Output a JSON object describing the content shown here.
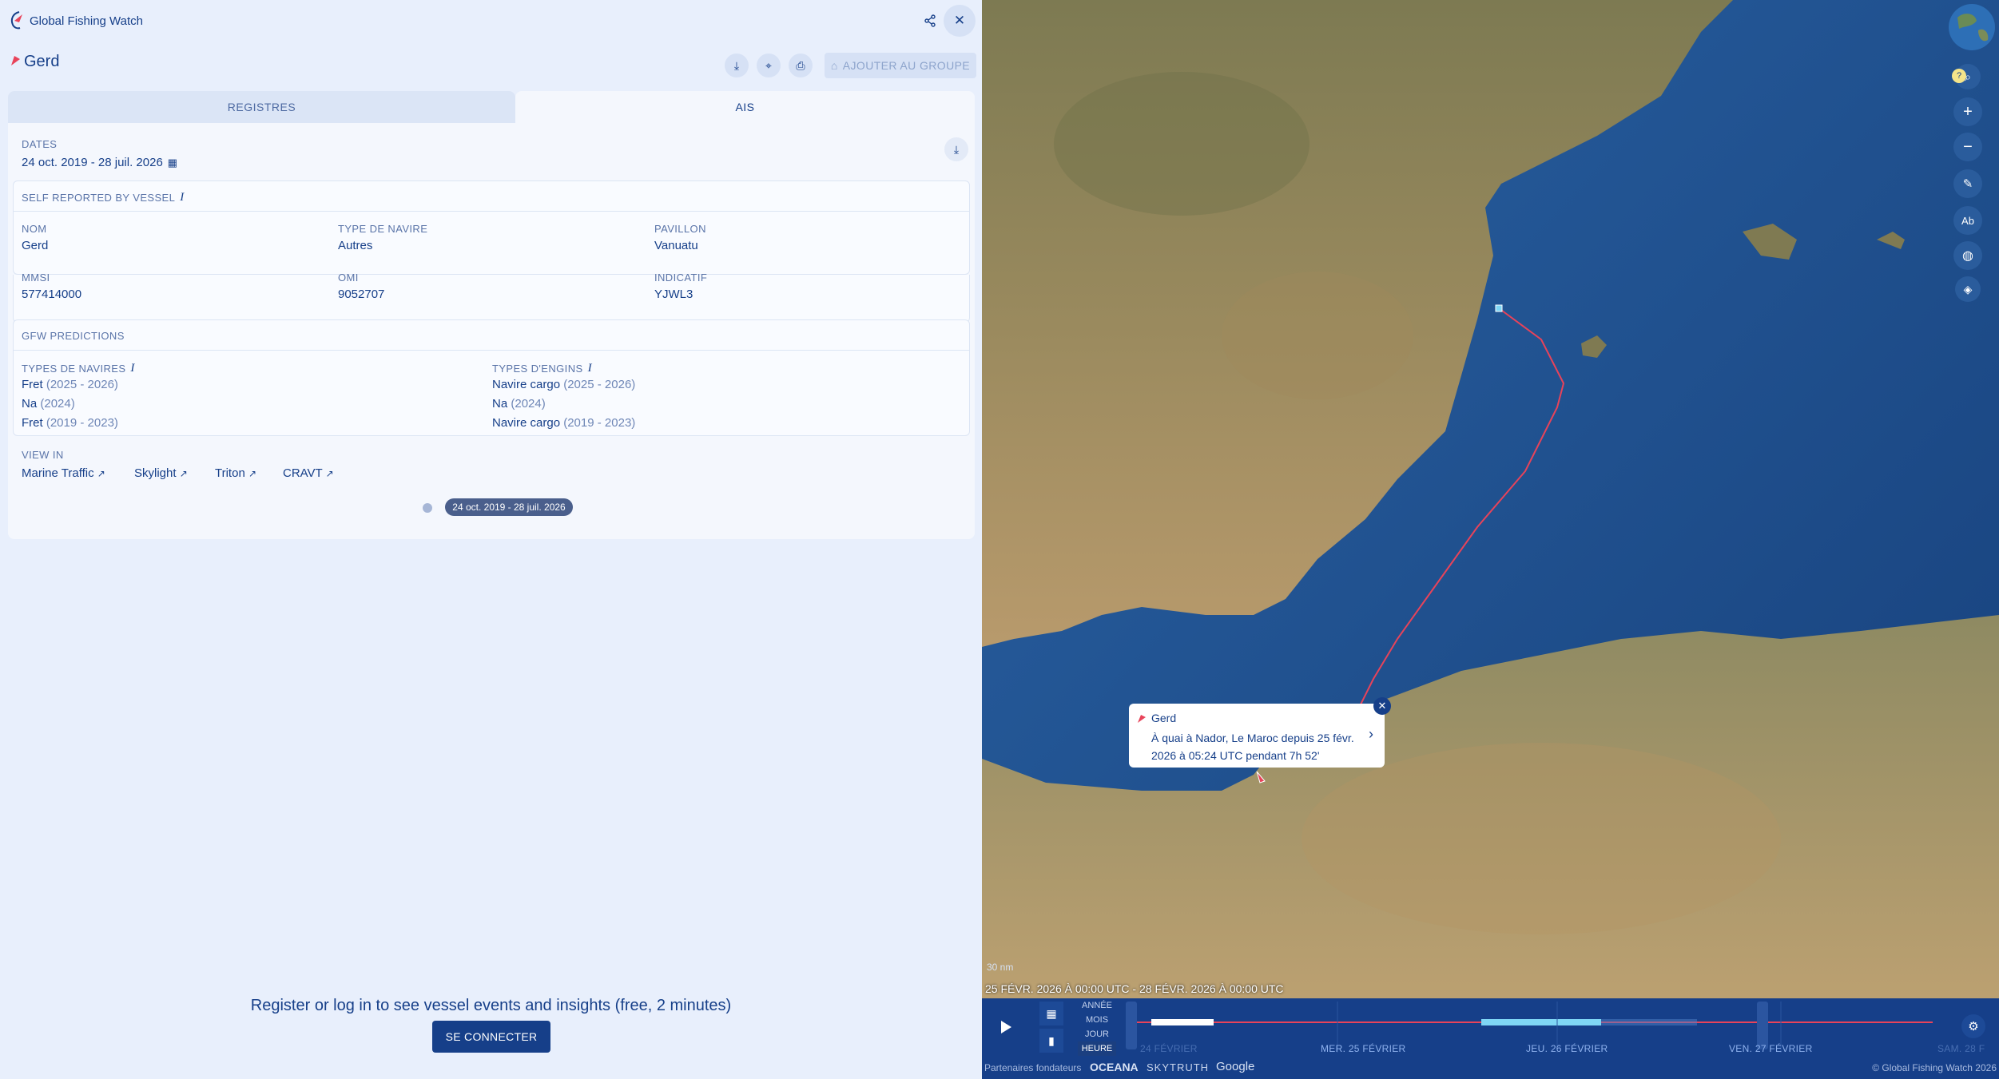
{
  "app": {
    "title": "Global Fishing Watch"
  },
  "vessel": {
    "name": "Gerd"
  },
  "actions": {
    "add_to_group": "AJOUTER AU GROUPE"
  },
  "tabs": [
    "REGISTRES",
    "AIS"
  ],
  "dates": {
    "label": "DATES",
    "value": "24 oct. 2019 - 28 juil. 2026"
  },
  "self_reported": {
    "title": "SELF REPORTED BY VESSEL",
    "fields": [
      {
        "label": "NOM",
        "value": "Gerd"
      },
      {
        "label": "TYPE DE NAVIRE",
        "value": "Autres"
      },
      {
        "label": "PAVILLON",
        "value": "Vanuatu"
      },
      {
        "label": "MMSI",
        "value": "577414000"
      },
      {
        "label": "OMI",
        "value": "9052707"
      },
      {
        "label": "INDICATIF",
        "value": "YJWL3"
      }
    ]
  },
  "predictions": {
    "title": "GFW PREDICTIONS",
    "vessel_types_label": "TYPES DE NAVIRES",
    "gear_types_label": "TYPES D'ENGINS",
    "vessel_types": [
      {
        "name": "Fret",
        "period": "(2025 - 2026)"
      },
      {
        "name": "Na",
        "period": "(2024)"
      },
      {
        "name": "Fret",
        "period": "(2019 - 2023)"
      }
    ],
    "gear_types": [
      {
        "name": "Navire cargo",
        "period": "(2025 - 2026)"
      },
      {
        "name": "Na",
        "period": "(2024)"
      },
      {
        "name": "Navire cargo",
        "period": "(2019 - 2023)"
      }
    ]
  },
  "view_in": {
    "label": "VIEW IN",
    "links": [
      "Marine Traffic",
      "Skylight",
      "Triton",
      "CRAVT"
    ]
  },
  "timeline_pill": "24 oct. 2019 - 28 juil. 2026",
  "register": {
    "text": "Register or log in to see vessel events and insights (free, 2 minutes)",
    "button": "SE CONNECTER"
  },
  "map": {
    "popup": {
      "name": "Gerd",
      "text": "À quai à Nador, Le Maroc depuis 25 févr. 2026 à 05:24 UTC pendant 7h 52'"
    },
    "scale": "30 nm",
    "range": "25 FÉVR. 2026 À 00:00 UTC - 28 FÉVR. 2026 À 00:00 UTC",
    "granularity": [
      "ANNÉE",
      "MOIS",
      "JOUR",
      "HEURE"
    ],
    "days": [
      "24 FÉVRIER",
      "MER. 25 FÉVRIER",
      "JEU. 26 FÉVRIER",
      "VEN. 27 FÉVRIER",
      "SAM. 28 F"
    ],
    "footer": {
      "partners": "Partenaires fondateurs",
      "oceana": "OCEANA",
      "skytruth": "SKYTRUTH",
      "google": "Google",
      "copyright": "© Global Fishing Watch 2026"
    },
    "colors": {
      "track": "#e8435a",
      "ui_dark": "#163f89",
      "selection": "#7fd6f5"
    }
  }
}
